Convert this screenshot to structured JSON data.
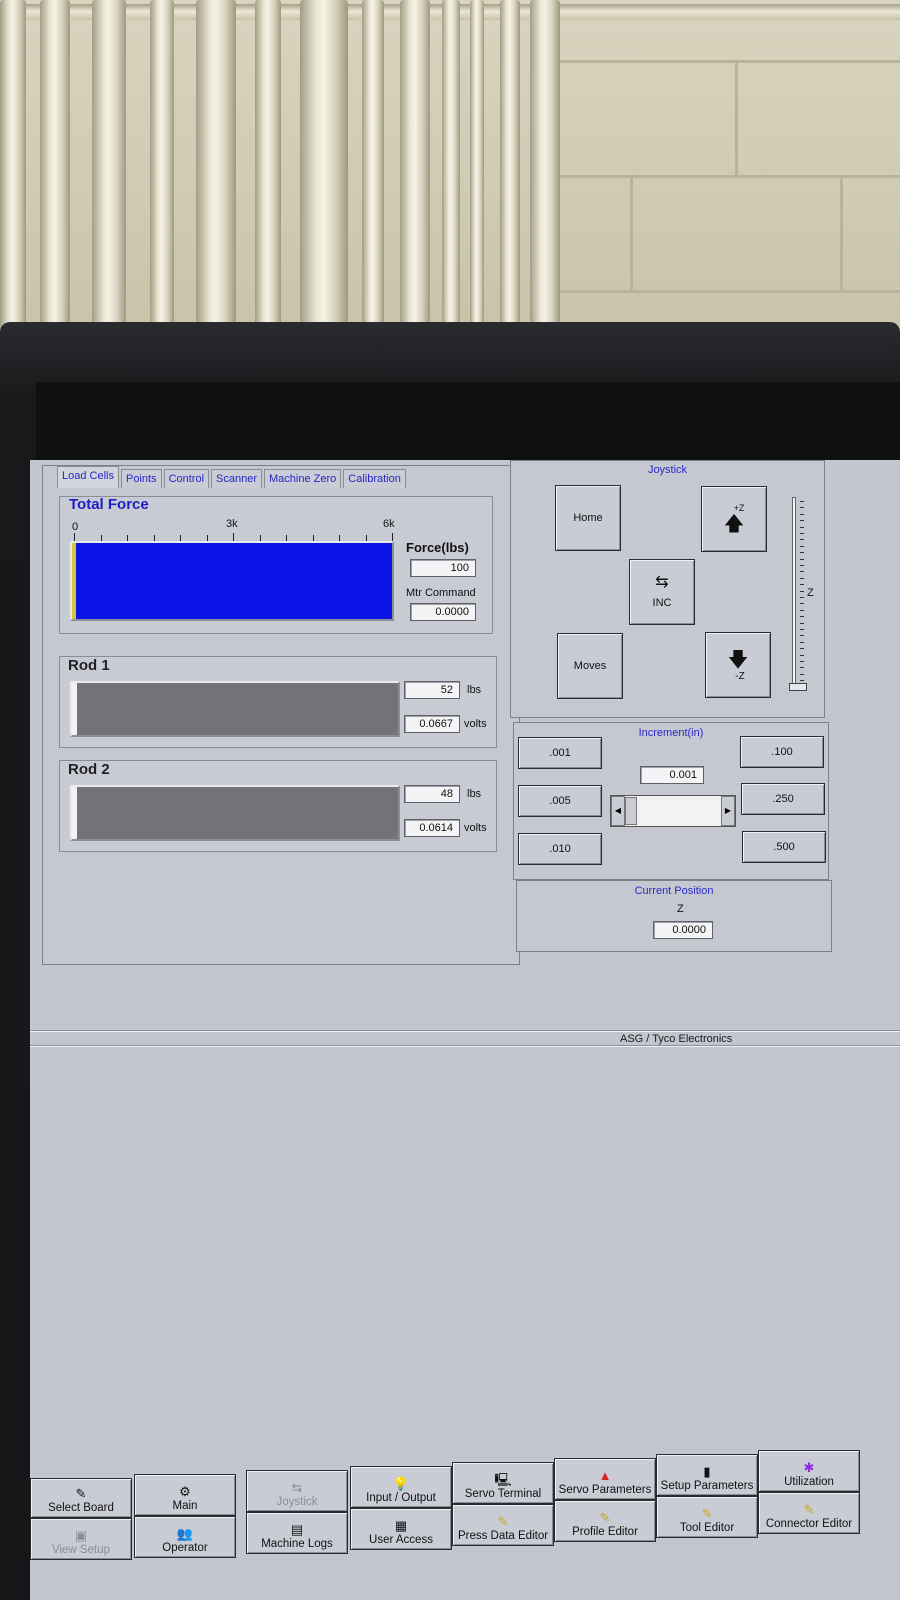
{
  "tabs": [
    "Load Cells",
    "Points",
    "Control",
    "Scanner",
    "Machine Zero",
    "Calibration"
  ],
  "total_force": {
    "title": "Total Force",
    "scale": [
      "0",
      "3k",
      "6k"
    ],
    "force_label": "Force(lbs)",
    "force_value": "100",
    "mtr_label": "Mtr Command",
    "mtr_value": "0.0000",
    "fill_color": "#0a14e6",
    "marker_color": "#d8c63a"
  },
  "rods": [
    {
      "title": "Rod 1",
      "lbs_value": "52",
      "lbs_unit": "lbs",
      "volts_value": "0.0667",
      "volts_unit": "volts"
    },
    {
      "title": "Rod 2",
      "lbs_value": "48",
      "lbs_unit": "lbs",
      "volts_value": "0.0614",
      "volts_unit": "volts"
    }
  ],
  "joystick": {
    "title": "Joystick",
    "home": "Home",
    "moves": "Moves",
    "inc": "INC",
    "plus_z": "+Z",
    "minus_z": "-Z",
    "axis": "Z"
  },
  "increment": {
    "title": "Increment(in)",
    "value": "0.001",
    "left_buttons": [
      ".001",
      ".005",
      ".010"
    ],
    "right_buttons": [
      ".100",
      ".250",
      ".500"
    ]
  },
  "current_position": {
    "title": "Current Position",
    "axis": "Z",
    "value": "0.0000"
  },
  "credit": "ASG / Tyco Electronics",
  "toolbar": {
    "select_board": "Select Board",
    "view_setup": "View Setup",
    "main": "Main",
    "operator": "Operator",
    "joystick": "Joystick",
    "machine_logs": "Machine Logs",
    "input_output": "Input / Output",
    "user_access": "User Access",
    "servo_terminal": "Servo Terminal",
    "press_data_editor": "Press Data Editor",
    "servo_parameters": "Servo Parameters",
    "profile_editor": "Profile Editor",
    "setup_parameters": "Setup Parameters",
    "tool_editor": "Tool Editor",
    "utilization": "Utilization",
    "connector_editor": "Connector Editor"
  }
}
